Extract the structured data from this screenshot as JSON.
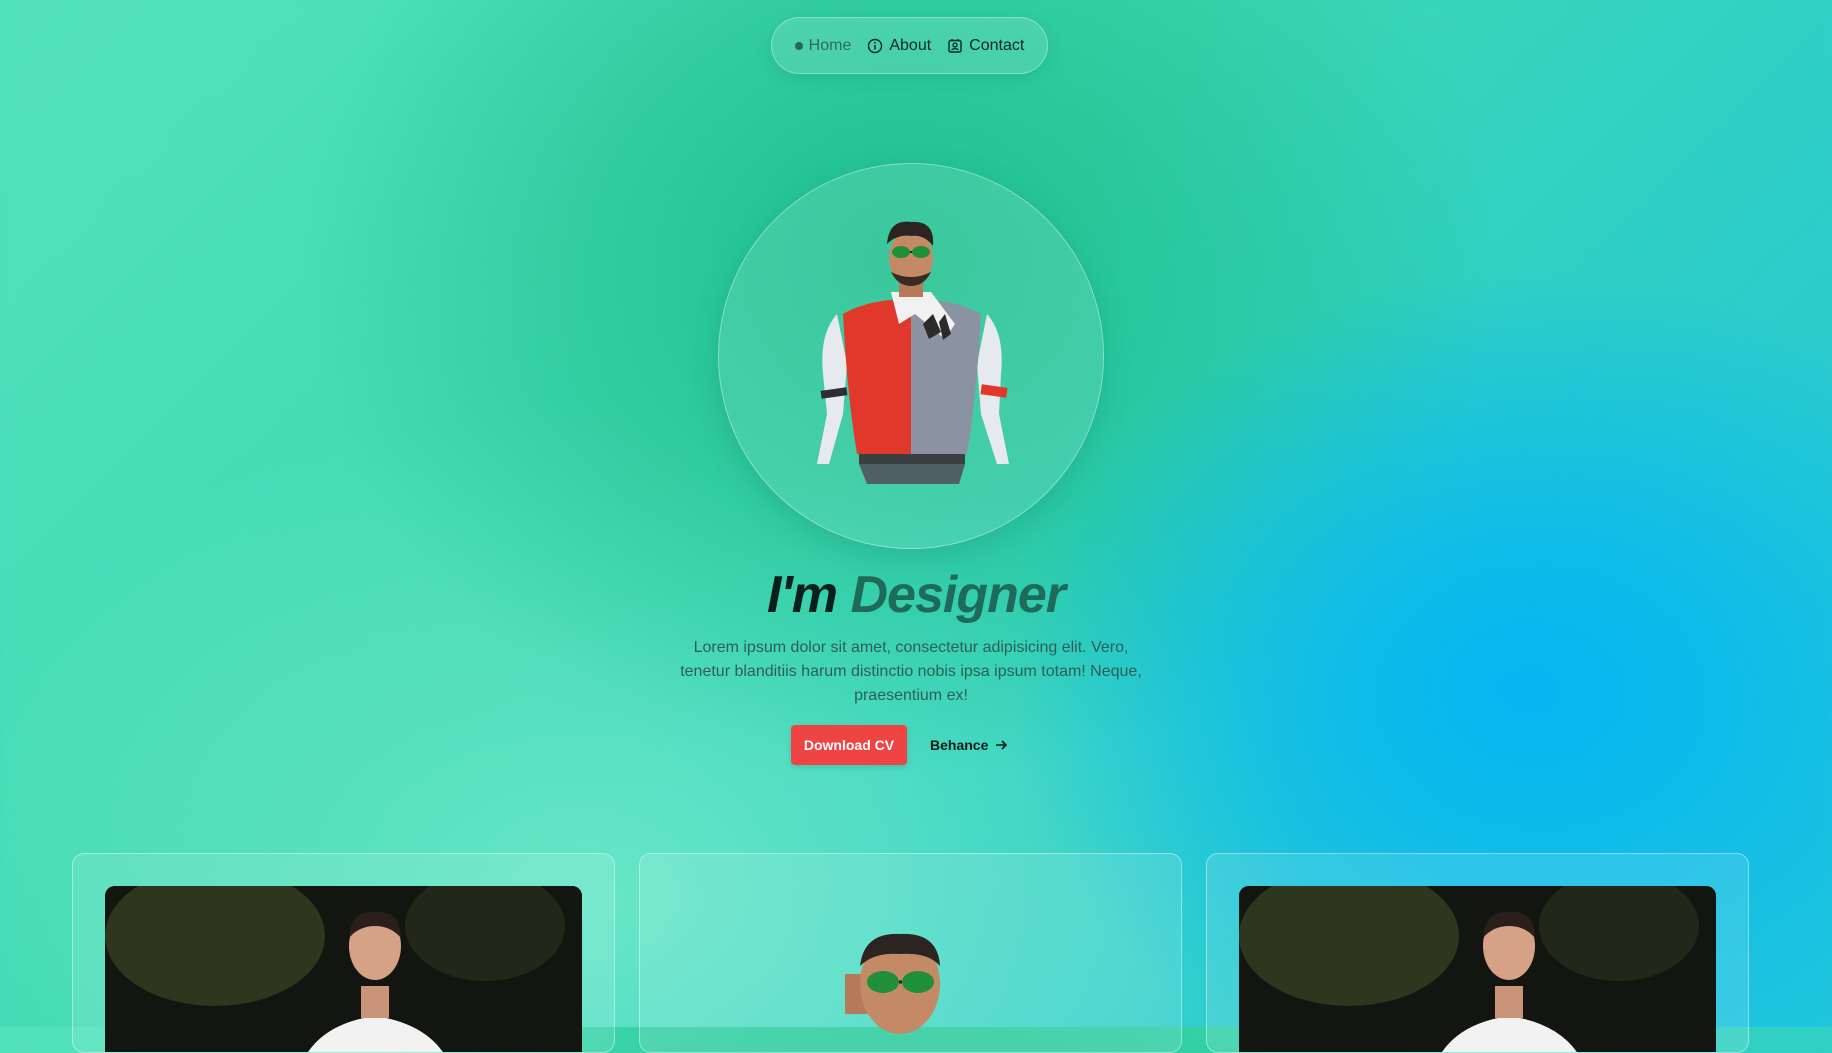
{
  "nav": {
    "items": [
      {
        "label": "Home",
        "icon": "dot-icon",
        "active": true
      },
      {
        "label": "About",
        "icon": "info-icon",
        "active": false
      },
      {
        "label": "Contact",
        "icon": "contact-icon",
        "active": false
      }
    ]
  },
  "hero": {
    "title_prefix": "I'm",
    "title_accent": "Designer",
    "description": "Lorem ipsum dolor sit amet, consectetur adipisicing elit. Vero, tenetur blanditiis harum distinctio nobis ipsa ipsum totam! Neque, praesentium ex!",
    "download_label": "Download CV",
    "behance_label": "Behance"
  },
  "colors": {
    "accent": "#1f6b5a",
    "button": "#ef4444",
    "bg_green": "#3fd9b2",
    "bg_blue": "#05b6f2"
  },
  "cards": [
    {
      "type": "photo"
    },
    {
      "type": "avatar"
    },
    {
      "type": "photo"
    }
  ]
}
